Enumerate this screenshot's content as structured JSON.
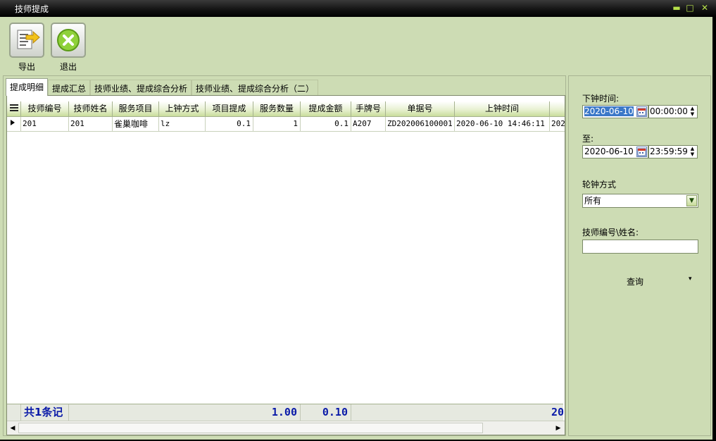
{
  "window": {
    "title": "技师提成",
    "minimize": "▬",
    "restore": "□",
    "close": "✕"
  },
  "toolbar": {
    "export_label": "导出",
    "exit_label": "退出"
  },
  "tabs": [
    {
      "label": "提成明细",
      "active": true
    },
    {
      "label": "提成汇总",
      "active": false
    },
    {
      "label": "技师业绩、提成综合分析",
      "active": false
    },
    {
      "label": "技师业绩、提成综合分析（二）",
      "active": false
    }
  ],
  "grid": {
    "columns": [
      "技师编号",
      "技师姓名",
      "服务项目",
      "上钟方式",
      "项目提成",
      "服务数量",
      "提成金额",
      "手牌号",
      "单据号",
      "上钟时间",
      ""
    ],
    "rows": [
      [
        "201",
        "201",
        "雀巢咖啡",
        "lz",
        "0.1",
        "1",
        "0.1",
        "A207",
        "ZD202006100001",
        "2020-06-10 14:46:11",
        "202"
      ]
    ],
    "footer": {
      "count": "共1条记",
      "qty_total": "1.00",
      "amount_total": "0.10",
      "tail": "20"
    }
  },
  "filters": {
    "end_time_label": "下钟时间:",
    "start_date": "2020-06-10",
    "start_time": "00:00:00",
    "to_label": "至:",
    "end_date": "2020-06-10",
    "end_time": "23:59:59",
    "rotation_label": "轮钟方式",
    "rotation_value": "所有",
    "tech_label": "技师编号\\姓名:",
    "tech_value": "",
    "query_label": "查询",
    "query_dropdown": "▾"
  }
}
